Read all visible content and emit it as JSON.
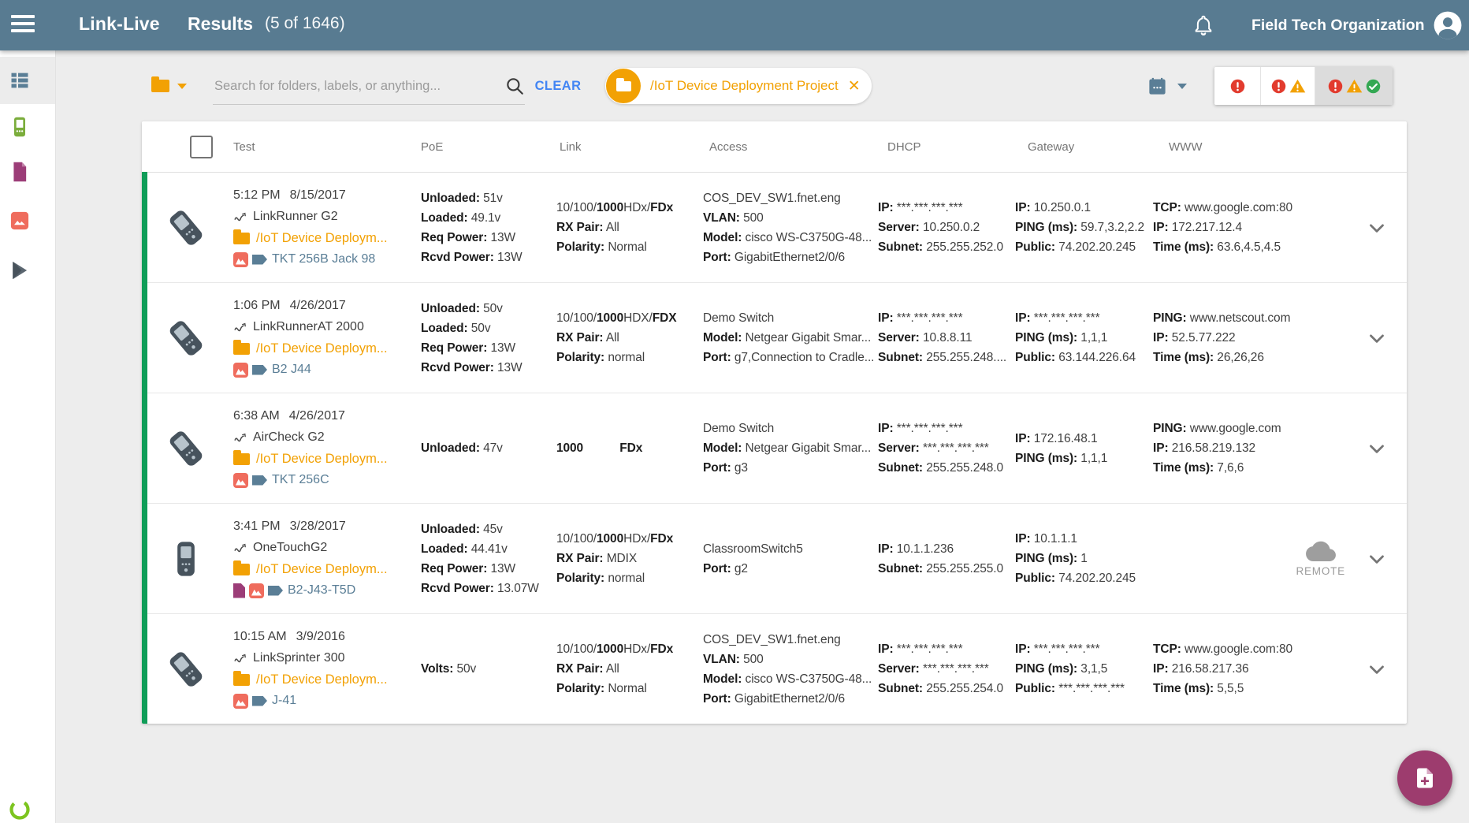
{
  "app_bar": {
    "title": "Link-Live",
    "page_title": "Results",
    "result_count": "(5 of 1646)",
    "org_name": "Field Tech Organization"
  },
  "sidebar": {
    "items": [
      {
        "icon": "results-list-icon",
        "selected": true
      },
      {
        "icon": "units-device-icon",
        "selected": false
      },
      {
        "icon": "reports-document-icon",
        "selected": false
      },
      {
        "icon": "photos-image-icon",
        "selected": false
      },
      {
        "icon": "app-play-icon",
        "selected": false
      }
    ],
    "logo_icon": "netscout-ring-logo"
  },
  "toolbar": {
    "folder_selector_icon": "folder-icon",
    "search_placeholder": "Search for folders, labels, or anything...",
    "search_icon": "magnifier-icon",
    "clear_label": "CLEAR",
    "chip": {
      "icon": "folder-icon",
      "label": "/IoT Device Deployment Project",
      "close_icon": "close-x-icon"
    },
    "date_selector_icon": "calendar-icon",
    "status_filters": [
      {
        "icons": [
          "error"
        ],
        "selected": false
      },
      {
        "icons": [
          "error",
          "warning"
        ],
        "selected": false
      },
      {
        "icons": [
          "error",
          "warning",
          "success"
        ],
        "selected": true
      }
    ]
  },
  "table": {
    "columns": [
      "Test",
      "PoE",
      "Link",
      "Access",
      "DHCP",
      "Gateway",
      "WWW"
    ],
    "remote_label": "REMOTE",
    "rows": [
      {
        "time": "5:12 PM",
        "date": "8/15/2017",
        "device_model": "LinkRunner G2",
        "device_icon": "linkrunner-g2-device-icon",
        "upright": false,
        "folder": "/IoT Device Deploym...",
        "tag_icons": [
          "image",
          "label"
        ],
        "tag_label": "TKT 256B Jack 98",
        "poe": [
          [
            [
              "Unloaded:",
              1
            ],
            [
              " 51v",
              0
            ]
          ],
          [
            [
              "Loaded:",
              1
            ],
            [
              " 49.1v",
              0
            ]
          ],
          [
            [
              "Req Power:",
              1
            ],
            [
              " 13W",
              0
            ]
          ],
          [
            [
              "Rcvd Power:",
              1
            ],
            [
              " 13W",
              0
            ]
          ]
        ],
        "link": [
          [
            [
              "10/100/",
              0
            ],
            [
              "1000",
              1
            ],
            [
              "HDx/",
              0
            ],
            [
              "FDx",
              1
            ]
          ],
          [
            [
              "RX Pair:",
              1
            ],
            [
              " All",
              0
            ]
          ],
          [
            [
              "Polarity:",
              1
            ],
            [
              " Normal",
              0
            ]
          ]
        ],
        "access": [
          [
            [
              "COS_DEV_SW1.fnet.eng",
              0
            ]
          ],
          [
            [
              "VLAN:",
              1
            ],
            [
              " 500",
              0
            ]
          ],
          [
            [
              "Model:",
              1
            ],
            [
              " cisco WS-C3750G-48...",
              0
            ]
          ],
          [
            [
              "Port:",
              1
            ],
            [
              " GigabitEthernet2/0/6",
              0
            ]
          ]
        ],
        "dhcp": [
          [
            [
              "IP:",
              1
            ],
            [
              " ***.***.***.***",
              0
            ]
          ],
          [
            [
              "Server:",
              1
            ],
            [
              " 10.250.0.2",
              0
            ]
          ],
          [
            [
              "Subnet:",
              1
            ],
            [
              " 255.255.252.0",
              0
            ]
          ]
        ],
        "gateway": [
          [
            [
              "IP:",
              1
            ],
            [
              " 10.250.0.1",
              0
            ]
          ],
          [
            [
              "PING (ms):",
              1
            ],
            [
              " 59.7,3.2,2.2",
              0
            ]
          ],
          [
            [
              "Public:",
              1
            ],
            [
              " 74.202.20.245",
              0
            ]
          ]
        ],
        "www": [
          [
            [
              "TCP:",
              1
            ],
            [
              " www.google.com:80",
              0
            ]
          ],
          [
            [
              "IP:",
              1
            ],
            [
              " 172.217.12.4",
              0
            ]
          ],
          [
            [
              "Time (ms):",
              1
            ],
            [
              " 63.6,4.5,4.5",
              0
            ]
          ]
        ],
        "www_remote": false
      },
      {
        "time": "1:06 PM",
        "date": "4/26/2017",
        "device_model": "LinkRunnerAT 2000",
        "device_icon": "linkrunner-at-2000-device-icon",
        "upright": false,
        "folder": "/IoT Device Deploym...",
        "tag_icons": [
          "image",
          "label"
        ],
        "tag_label": "B2 J44",
        "poe": [
          [
            [
              "Unloaded:",
              1
            ],
            [
              " 50v",
              0
            ]
          ],
          [
            [
              "Loaded:",
              1
            ],
            [
              " 50v",
              0
            ]
          ],
          [
            [
              "Req Power:",
              1
            ],
            [
              " 13W",
              0
            ]
          ],
          [
            [
              "Rcvd Power:",
              1
            ],
            [
              " 13W",
              0
            ]
          ]
        ],
        "link": [
          [
            [
              "10/100/",
              0
            ],
            [
              "1000",
              1
            ],
            [
              "HDX/",
              0
            ],
            [
              "FDX",
              1
            ]
          ],
          [
            [
              "RX Pair:",
              1
            ],
            [
              " All",
              0
            ]
          ],
          [
            [
              "Polarity:",
              1
            ],
            [
              " normal",
              0
            ]
          ]
        ],
        "access": [
          [
            [
              "Demo Switch",
              0
            ]
          ],
          [
            [
              "Model:",
              1
            ],
            [
              " Netgear Gigabit Smar...",
              0
            ]
          ],
          [
            [
              "Port:",
              1
            ],
            [
              " g7,Connection to Cradle...",
              0
            ]
          ]
        ],
        "dhcp": [
          [
            [
              "IP:",
              1
            ],
            [
              " ***.***.***.***",
              0
            ]
          ],
          [
            [
              "Server:",
              1
            ],
            [
              " 10.8.8.11",
              0
            ]
          ],
          [
            [
              "Subnet:",
              1
            ],
            [
              " 255.255.248....",
              0
            ]
          ]
        ],
        "gateway": [
          [
            [
              "IP:",
              1
            ],
            [
              " ***.***.***.***",
              0
            ]
          ],
          [
            [
              "PING (ms):",
              1
            ],
            [
              " 1,1,1",
              0
            ]
          ],
          [
            [
              "Public:",
              1
            ],
            [
              " 63.144.226.64",
              0
            ]
          ]
        ],
        "www": [
          [
            [
              "PING:",
              1
            ],
            [
              " www.netscout.com",
              0
            ]
          ],
          [
            [
              "IP:",
              1
            ],
            [
              " 52.5.77.222",
              0
            ]
          ],
          [
            [
              "Time (ms):",
              1
            ],
            [
              " 26,26,26",
              0
            ]
          ]
        ],
        "www_remote": false
      },
      {
        "time": "6:38 AM",
        "date": "4/26/2017",
        "device_model": "AirCheck G2",
        "device_icon": "aircheck-g2-device-icon",
        "upright": false,
        "folder": "/IoT Device Deploym...",
        "tag_icons": [
          "image",
          "label"
        ],
        "tag_label": "TKT 256C",
        "poe": [
          [
            [
              "Unloaded:",
              1
            ],
            [
              " 47v",
              0
            ]
          ]
        ],
        "link": [
          [
            [
              "1000",
              1
            ],
            [
              "   ",
              0
            ],
            [
              "FDx",
              1
            ]
          ]
        ],
        "access": [
          [
            [
              "Demo Switch",
              0
            ]
          ],
          [
            [
              "Model:",
              1
            ],
            [
              " Netgear Gigabit Smar...",
              0
            ]
          ],
          [
            [
              "Port:",
              1
            ],
            [
              " g3",
              0
            ]
          ]
        ],
        "dhcp": [
          [
            [
              "IP:",
              1
            ],
            [
              " ***.***.***.***",
              0
            ]
          ],
          [
            [
              "Server:",
              1
            ],
            [
              " ***.***.***.***",
              0
            ]
          ],
          [
            [
              "Subnet:",
              1
            ],
            [
              " 255.255.248.0",
              0
            ]
          ]
        ],
        "gateway": [
          [
            [
              "IP:",
              1
            ],
            [
              " 172.16.48.1",
              0
            ]
          ],
          [
            [
              "PING (ms):",
              1
            ],
            [
              " 1,1,1",
              0
            ]
          ]
        ],
        "www": [
          [
            [
              "PING:",
              1
            ],
            [
              " www.google.com",
              0
            ]
          ],
          [
            [
              "IP:",
              1
            ],
            [
              " 216.58.219.132",
              0
            ]
          ],
          [
            [
              "Time (ms):",
              1
            ],
            [
              " 7,6,6",
              0
            ]
          ]
        ],
        "www_remote": false
      },
      {
        "time": "3:41 PM",
        "date": "3/28/2017",
        "device_model": "OneTouchG2",
        "device_icon": "onetouch-g2-device-icon",
        "upright": true,
        "folder": "/IoT Device Deploym...",
        "tag_icons": [
          "document",
          "image",
          "label"
        ],
        "tag_label": "B2-J43-T5D",
        "poe": [
          [
            [
              "Unloaded:",
              1
            ],
            [
              " 45v",
              0
            ]
          ],
          [
            [
              "Loaded:",
              1
            ],
            [
              " 44.41v",
              0
            ]
          ],
          [
            [
              "Req Power:",
              1
            ],
            [
              " 13W",
              0
            ]
          ],
          [
            [
              "Rcvd Power:",
              1
            ],
            [
              " 13.07W",
              0
            ]
          ]
        ],
        "link": [
          [
            [
              "10/100/",
              0
            ],
            [
              "1000",
              1
            ],
            [
              "HDx/",
              0
            ],
            [
              "FDx",
              1
            ]
          ],
          [
            [
              "RX Pair:",
              1
            ],
            [
              " MDIX",
              0
            ]
          ],
          [
            [
              "Polarity:",
              1
            ],
            [
              " normal",
              0
            ]
          ]
        ],
        "access": [
          [
            [
              "ClassroomSwitch5",
              0
            ]
          ],
          [
            [
              "Port:",
              1
            ],
            [
              " g2",
              0
            ]
          ]
        ],
        "dhcp": [
          [
            [
              "IP:",
              1
            ],
            [
              " 10.1.1.236",
              0
            ]
          ],
          [
            [
              "Subnet:",
              1
            ],
            [
              " 255.255.255.0",
              0
            ]
          ]
        ],
        "gateway": [
          [
            [
              "IP:",
              1
            ],
            [
              " 10.1.1.1",
              0
            ]
          ],
          [
            [
              "PING (ms):",
              1
            ],
            [
              " 1",
              0
            ]
          ],
          [
            [
              "Public:",
              1
            ],
            [
              " 74.202.20.245",
              0
            ]
          ]
        ],
        "www": [],
        "www_remote": true
      },
      {
        "time": "10:15 AM",
        "date": "3/9/2016",
        "device_model": "LinkSprinter 300",
        "device_icon": "linksprinter-300-device-icon",
        "upright": false,
        "folder": "/IoT Device Deploym...",
        "tag_icons": [
          "image",
          "label"
        ],
        "tag_label": "J-41",
        "poe": [
          [
            [
              "Volts:",
              1
            ],
            [
              " 50v",
              0
            ]
          ]
        ],
        "link": [
          [
            [
              "10/100/",
              0
            ],
            [
              "1000",
              1
            ],
            [
              "HDx/",
              0
            ],
            [
              "FDx",
              1
            ]
          ],
          [
            [
              "RX Pair:",
              1
            ],
            [
              " All",
              0
            ]
          ],
          [
            [
              "Polarity:",
              1
            ],
            [
              " Normal",
              0
            ]
          ]
        ],
        "access": [
          [
            [
              "COS_DEV_SW1.fnet.eng",
              0
            ]
          ],
          [
            [
              "VLAN:",
              1
            ],
            [
              " 500",
              0
            ]
          ],
          [
            [
              "Model:",
              1
            ],
            [
              " cisco WS-C3750G-48...",
              0
            ]
          ],
          [
            [
              "Port:",
              1
            ],
            [
              " GigabitEthernet2/0/6",
              0
            ]
          ]
        ],
        "dhcp": [
          [
            [
              "IP:",
              1
            ],
            [
              " ***.***.***.***",
              0
            ]
          ],
          [
            [
              "Server:",
              1
            ],
            [
              " ***.***.***.***",
              0
            ]
          ],
          [
            [
              "Subnet:",
              1
            ],
            [
              " 255.255.254.0",
              0
            ]
          ]
        ],
        "gateway": [
          [
            [
              "IP:",
              1
            ],
            [
              " ***.***.***.***",
              0
            ]
          ],
          [
            [
              "PING (ms):",
              1
            ],
            [
              " 3,1,5",
              0
            ]
          ],
          [
            [
              "Public:",
              1
            ],
            [
              " ***.***.***.***",
              0
            ]
          ]
        ],
        "www": [
          [
            [
              "TCP:",
              1
            ],
            [
              " www.google.com:80",
              0
            ]
          ],
          [
            [
              "IP:",
              1
            ],
            [
              " 216.58.217.36",
              0
            ]
          ],
          [
            [
              "Time (ms):",
              1
            ],
            [
              " 5,5,5",
              0
            ]
          ]
        ],
        "www_remote": false
      }
    ]
  },
  "colors": {
    "appbar_bg": "#587b91",
    "orange": "#f2a104",
    "blue": "#4285f4",
    "green": "#0f9d58",
    "red": "#e23b2e",
    "warning": "#f2a104",
    "success": "#34a853",
    "fab": "#9d3c6e",
    "salmon": "#ef6c5d",
    "purple": "#9c3d78",
    "tag_slate": "#5a7e96",
    "sidebar_green": "#7bad3c",
    "logo_green": "#7cc41f"
  }
}
